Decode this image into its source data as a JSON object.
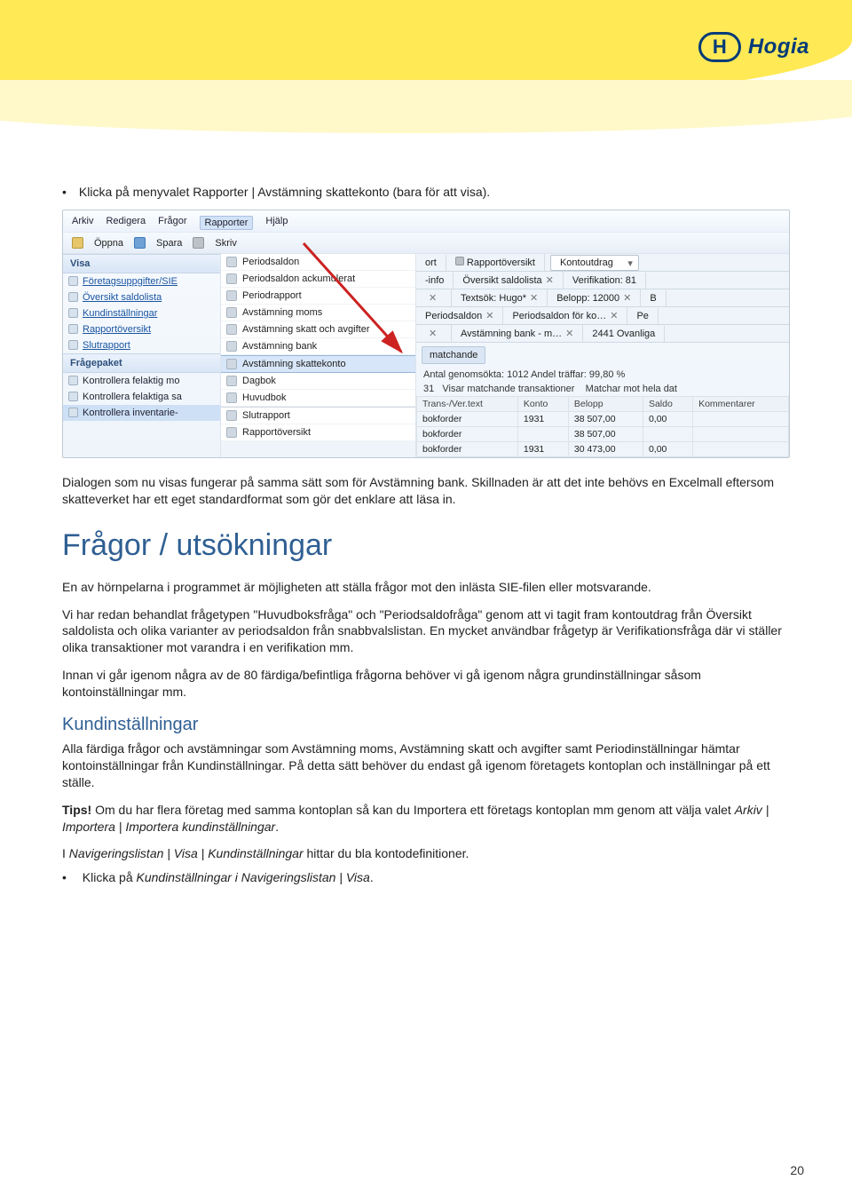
{
  "logo_text": "Hogia",
  "bullet1": "Klicka på menyvalet Rapporter | Avstämning skattekonto (bara för att visa).",
  "screenshot": {
    "menubar": [
      "Arkiv",
      "Redigera",
      "Frågor",
      "Rapporter",
      "Hjälp"
    ],
    "toolbar": [
      "Öppna",
      "Spara",
      "Skriv"
    ],
    "visa_title": "Visa",
    "visa_items": [
      "Företagsuppgifter/SIE",
      "Översikt saldolista",
      "Kundinställningar",
      "Rapportöversikt",
      "Slutrapport"
    ],
    "fragepaket_title": "Frågepaket",
    "fragepaket_items": [
      "Kontrollera felaktig mo",
      "Kontrollera felaktiga sa",
      "Kontrollera inventarie-"
    ],
    "rapporter_menu": [
      "Periodsaldon",
      "Periodsaldon ackumulerat",
      "Periodrapport",
      "Avstämning moms",
      "Avstämning skatt och avgifter",
      "Avstämning bank",
      "Avstämning skattekonto",
      "Dagbok",
      "Huvudbok",
      "Slutrapport",
      "Rapportöversikt"
    ],
    "upper_tabs": {
      "row1_left": "ort",
      "row1_a": "Rapportöversikt",
      "row1_drop": "Kontoutdrag",
      "row2_a": "-info",
      "row2_b": "Översikt saldolista",
      "row2_c": "Verifikation: 81",
      "row3_b": "Textsök: Hugo*",
      "row3_c": "Belopp: 12000",
      "row3_d": "B",
      "row4_a": "Periodsaldon",
      "row4_b": "Periodsaldon för ko…",
      "row4_c": "Pe",
      "row5_b": "Avstämning bank - m…",
      "row5_c": "2441 Ovanliga"
    },
    "matchande": "matchande",
    "stats1": "Antal genomsökta: 1012  Andel träffar: 99,80 %",
    "stats2_left": "31",
    "stats2_a": "Visar matchande transaktioner",
    "stats2_b": "Matchar mot hela dat",
    "table": {
      "headers": [
        "Trans-/Ver.text",
        "Konto",
        "Belopp",
        "Saldo",
        "Kommentarer"
      ],
      "rows": [
        [
          "bokforder",
          "1931",
          "38 507,00",
          "0,00",
          ""
        ],
        [
          "bokforder",
          "",
          "38 507,00",
          "",
          ""
        ],
        [
          "bokforder",
          "1931",
          "30 473,00",
          "0,00",
          ""
        ]
      ]
    }
  },
  "para_dialog": "Dialogen som nu visas fungerar på samma sätt som för Avstämning bank. Skillnaden är att det inte behövs en Excelmall eftersom skatteverket har ett eget standardformat som gör det enklare att läsa in.",
  "heading_fragor": "Frågor / utsökningar",
  "para_f1": "En av hörnpelarna i programmet är möjligheten att ställa frågor mot den inlästa SIE-filen eller motsvarande.",
  "para_f2": "Vi har redan behandlat frågetypen \"Huvudboksfråga\" och \"Periodsaldofråga\" genom att vi tagit fram kontoutdrag från Översikt saldolista och olika varianter av periodsaldon från snabbvalslistan. En mycket användbar frågetyp är Verifikationsfråga där vi ställer olika transaktioner mot varandra i en verifikation mm.",
  "para_f3": "Innan vi går igenom några av de 80 färdiga/befintliga frågorna behöver vi gå igenom några grundinställningar såsom kontoinställningar mm.",
  "heading_kund": "Kundinställningar",
  "para_k1": "Alla färdiga frågor och avstämningar som Avstämning moms, Avstämning skatt och avgifter samt Periodinställningar hämtar kontoinställningar från Kundinställningar. På detta sätt behöver du endast gå igenom företagets kontoplan och inställningar på ett ställe.",
  "tips_label": "Tips!",
  "tips_text": " Om du har flera företag med samma kontoplan så kan du Importera ett företags kontoplan mm genom att välja valet ",
  "tips_italic": "Arkiv | Importera | Importera kundinställningar",
  "para_k3a": "I ",
  "para_k3_ital": "Navigeringslistan | Visa | Kundinställningar",
  "para_k3b": " hittar du bla kontodefinitioner.",
  "bullet2a": "Klicka på ",
  "bullet2_ital": "Kundinställningar i Navigeringslistan | Visa",
  "page_num": "20"
}
